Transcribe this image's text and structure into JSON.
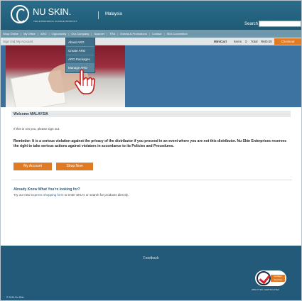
{
  "header": {
    "brand": "NU SKIN.",
    "tagline": "THE EXPERIENCE CHANGE PRODUCT",
    "country": "Malaysia",
    "search_label": "Search",
    "search_value": ""
  },
  "nav": {
    "items": [
      "Shop Online",
      "My Office",
      "ARO",
      "Opportunity",
      "Our Company",
      "Scanner",
      "TRA",
      "Events & Promotions",
      "Contact",
      "SEA Convention"
    ]
  },
  "subbar": {
    "sign_out": "Sign Out",
    "my_account": "My Account",
    "minicart": "MiniCart",
    "items_label": "Items",
    "items_count": "0",
    "total_label": "Total",
    "total_value": "RM0.00",
    "checkout": "Checkout"
  },
  "dropdown": {
    "items": [
      "About ARO",
      "Create ARO",
      "ARO Packages",
      "Manage ARO"
    ],
    "highlighted_index": 3
  },
  "content": {
    "welcome": "Welcome MALAYSIA",
    "not_you": "If this is not you, please sign out.",
    "reminder": "Reminder: It is a serious violation against the privacy of the distributor if you proceed in an event where you are not this distributor. Nu Skin Enterprises reserves the right to take serious actions against violators in accordance to its Policies and Procedures.",
    "btn_my_account": "My Account",
    "btn_shop_now": "Shop Now",
    "already_heading": "Already Know What You're looking for?",
    "try_prefix": "Try our new ",
    "try_link": "express shopping form",
    "try_suffix": " to enter SKU's or search for products directly."
  },
  "footer": {
    "feedback": "Feedback",
    "verisign_badge": "VeriSign Secured",
    "verisign_label": "ABOUT SSL CERTIFICATES",
    "copyright": "© 2010 Nu Skin"
  },
  "colors": {
    "header_blue": "#245a79",
    "nav_blue": "#6f98ab",
    "accent_orange": "#e07b25"
  }
}
